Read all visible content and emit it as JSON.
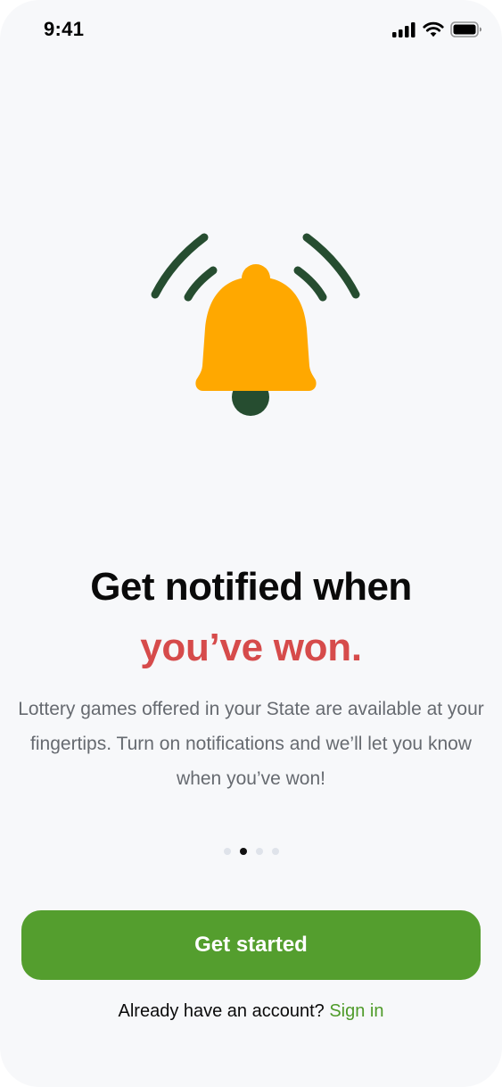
{
  "status_bar": {
    "time": "9:41",
    "icons": [
      "cellular-signal-icon",
      "wifi-icon",
      "battery-icon"
    ]
  },
  "illustration": {
    "icon": "ringing-bell-icon",
    "colors": {
      "bell": "#FFA800",
      "clapper_and_waves": "#264D30"
    }
  },
  "onboarding": {
    "headline_line1": "Get notified when",
    "headline_line2": "you’ve won.",
    "description": "Lottery games offered in your State are available at your fingertips. Turn on notifications and we’ll let you know when you’ve won!",
    "pager": {
      "total_pages": 4,
      "active_page": 2
    }
  },
  "actions": {
    "primary_label": "Get started",
    "signin_prompt": "Already have an account?",
    "signin_link": "Sign in"
  },
  "colors": {
    "background": "#F7F8FA",
    "headline_accent": "#D64B4B",
    "primary_button": "#549E2E",
    "link": "#4F9B2A",
    "body_text": "#666A70"
  }
}
